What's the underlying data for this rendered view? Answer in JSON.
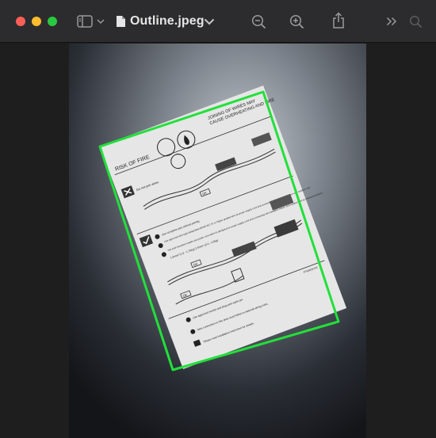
{
  "window": {
    "title": "Outline.jpeg"
  },
  "toolbar": {
    "icons": [
      "sidebar-icon",
      "chevron-down-icon",
      "document-icon",
      "zoom-out-icon",
      "zoom-in-icon",
      "share-icon",
      "more-icon",
      "search-icon"
    ]
  },
  "document": {
    "header_line1": "JOINING OF WIRES MAY",
    "header_line2": "CAUSE OVERHEATING AND FIRE",
    "risk_label": "RISK OF FIRE",
    "no_joint": "Do not join wires",
    "ok1": "OK",
    "ok2": "OK",
    "ok3": "OK",
    "instr1": "Use complete wire without joining.",
    "instr2": "Use approved wire type designated 60245 IEC 57 or higher graded wire as power supply cord and connecting wire between indoor and outdoor unit.",
    "instr3": "The wall mounted models use power cord which is designed for power supply cord and connecting wire between indoor and outdoor unit as mentioned below.",
    "instr4": "1.5mm² (1.0 - 1.75kg)   2.5mm² (2.0 - 2.5kg)",
    "instr5": "Use approved socket and plug with earth pin.",
    "instr6": "Wire connection in this area must follow to national wiring rules.",
    "instr7": "Please read installation instruction for details.",
    "code": "F763016 AA"
  },
  "colors": {
    "outline": "#22e03a",
    "close": "#ff5f57",
    "minimize": "#febc2e",
    "zoom": "#28c840"
  }
}
